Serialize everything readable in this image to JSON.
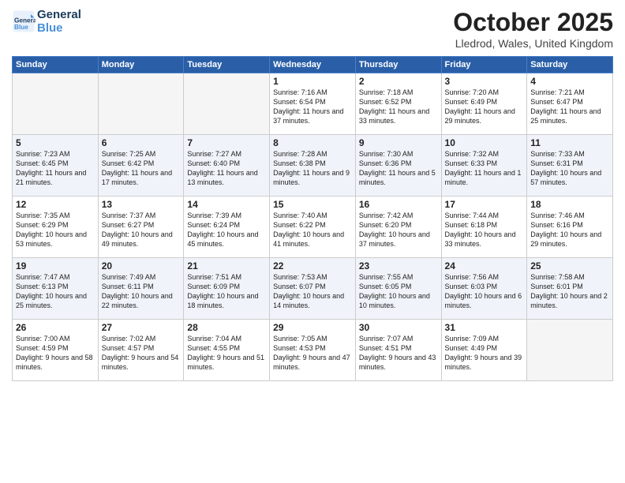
{
  "logo": {
    "line1": "General",
    "line2": "Blue"
  },
  "title": "October 2025",
  "location": "Lledrod, Wales, United Kingdom",
  "days_of_week": [
    "Sunday",
    "Monday",
    "Tuesday",
    "Wednesday",
    "Thursday",
    "Friday",
    "Saturday"
  ],
  "weeks": [
    [
      {
        "day": "",
        "info": ""
      },
      {
        "day": "",
        "info": ""
      },
      {
        "day": "",
        "info": ""
      },
      {
        "day": "1",
        "info": "Sunrise: 7:16 AM\nSunset: 6:54 PM\nDaylight: 11 hours and 37 minutes."
      },
      {
        "day": "2",
        "info": "Sunrise: 7:18 AM\nSunset: 6:52 PM\nDaylight: 11 hours and 33 minutes."
      },
      {
        "day": "3",
        "info": "Sunrise: 7:20 AM\nSunset: 6:49 PM\nDaylight: 11 hours and 29 minutes."
      },
      {
        "day": "4",
        "info": "Sunrise: 7:21 AM\nSunset: 6:47 PM\nDaylight: 11 hours and 25 minutes."
      }
    ],
    [
      {
        "day": "5",
        "info": "Sunrise: 7:23 AM\nSunset: 6:45 PM\nDaylight: 11 hours and 21 minutes."
      },
      {
        "day": "6",
        "info": "Sunrise: 7:25 AM\nSunset: 6:42 PM\nDaylight: 11 hours and 17 minutes."
      },
      {
        "day": "7",
        "info": "Sunrise: 7:27 AM\nSunset: 6:40 PM\nDaylight: 11 hours and 13 minutes."
      },
      {
        "day": "8",
        "info": "Sunrise: 7:28 AM\nSunset: 6:38 PM\nDaylight: 11 hours and 9 minutes."
      },
      {
        "day": "9",
        "info": "Sunrise: 7:30 AM\nSunset: 6:36 PM\nDaylight: 11 hours and 5 minutes."
      },
      {
        "day": "10",
        "info": "Sunrise: 7:32 AM\nSunset: 6:33 PM\nDaylight: 11 hours and 1 minute."
      },
      {
        "day": "11",
        "info": "Sunrise: 7:33 AM\nSunset: 6:31 PM\nDaylight: 10 hours and 57 minutes."
      }
    ],
    [
      {
        "day": "12",
        "info": "Sunrise: 7:35 AM\nSunset: 6:29 PM\nDaylight: 10 hours and 53 minutes."
      },
      {
        "day": "13",
        "info": "Sunrise: 7:37 AM\nSunset: 6:27 PM\nDaylight: 10 hours and 49 minutes."
      },
      {
        "day": "14",
        "info": "Sunrise: 7:39 AM\nSunset: 6:24 PM\nDaylight: 10 hours and 45 minutes."
      },
      {
        "day": "15",
        "info": "Sunrise: 7:40 AM\nSunset: 6:22 PM\nDaylight: 10 hours and 41 minutes."
      },
      {
        "day": "16",
        "info": "Sunrise: 7:42 AM\nSunset: 6:20 PM\nDaylight: 10 hours and 37 minutes."
      },
      {
        "day": "17",
        "info": "Sunrise: 7:44 AM\nSunset: 6:18 PM\nDaylight: 10 hours and 33 minutes."
      },
      {
        "day": "18",
        "info": "Sunrise: 7:46 AM\nSunset: 6:16 PM\nDaylight: 10 hours and 29 minutes."
      }
    ],
    [
      {
        "day": "19",
        "info": "Sunrise: 7:47 AM\nSunset: 6:13 PM\nDaylight: 10 hours and 25 minutes."
      },
      {
        "day": "20",
        "info": "Sunrise: 7:49 AM\nSunset: 6:11 PM\nDaylight: 10 hours and 22 minutes."
      },
      {
        "day": "21",
        "info": "Sunrise: 7:51 AM\nSunset: 6:09 PM\nDaylight: 10 hours and 18 minutes."
      },
      {
        "day": "22",
        "info": "Sunrise: 7:53 AM\nSunset: 6:07 PM\nDaylight: 10 hours and 14 minutes."
      },
      {
        "day": "23",
        "info": "Sunrise: 7:55 AM\nSunset: 6:05 PM\nDaylight: 10 hours and 10 minutes."
      },
      {
        "day": "24",
        "info": "Sunrise: 7:56 AM\nSunset: 6:03 PM\nDaylight: 10 hours and 6 minutes."
      },
      {
        "day": "25",
        "info": "Sunrise: 7:58 AM\nSunset: 6:01 PM\nDaylight: 10 hours and 2 minutes."
      }
    ],
    [
      {
        "day": "26",
        "info": "Sunrise: 7:00 AM\nSunset: 4:59 PM\nDaylight: 9 hours and 58 minutes."
      },
      {
        "day": "27",
        "info": "Sunrise: 7:02 AM\nSunset: 4:57 PM\nDaylight: 9 hours and 54 minutes."
      },
      {
        "day": "28",
        "info": "Sunrise: 7:04 AM\nSunset: 4:55 PM\nDaylight: 9 hours and 51 minutes."
      },
      {
        "day": "29",
        "info": "Sunrise: 7:05 AM\nSunset: 4:53 PM\nDaylight: 9 hours and 47 minutes."
      },
      {
        "day": "30",
        "info": "Sunrise: 7:07 AM\nSunset: 4:51 PM\nDaylight: 9 hours and 43 minutes."
      },
      {
        "day": "31",
        "info": "Sunrise: 7:09 AM\nSunset: 4:49 PM\nDaylight: 9 hours and 39 minutes."
      },
      {
        "day": "",
        "info": ""
      }
    ]
  ]
}
